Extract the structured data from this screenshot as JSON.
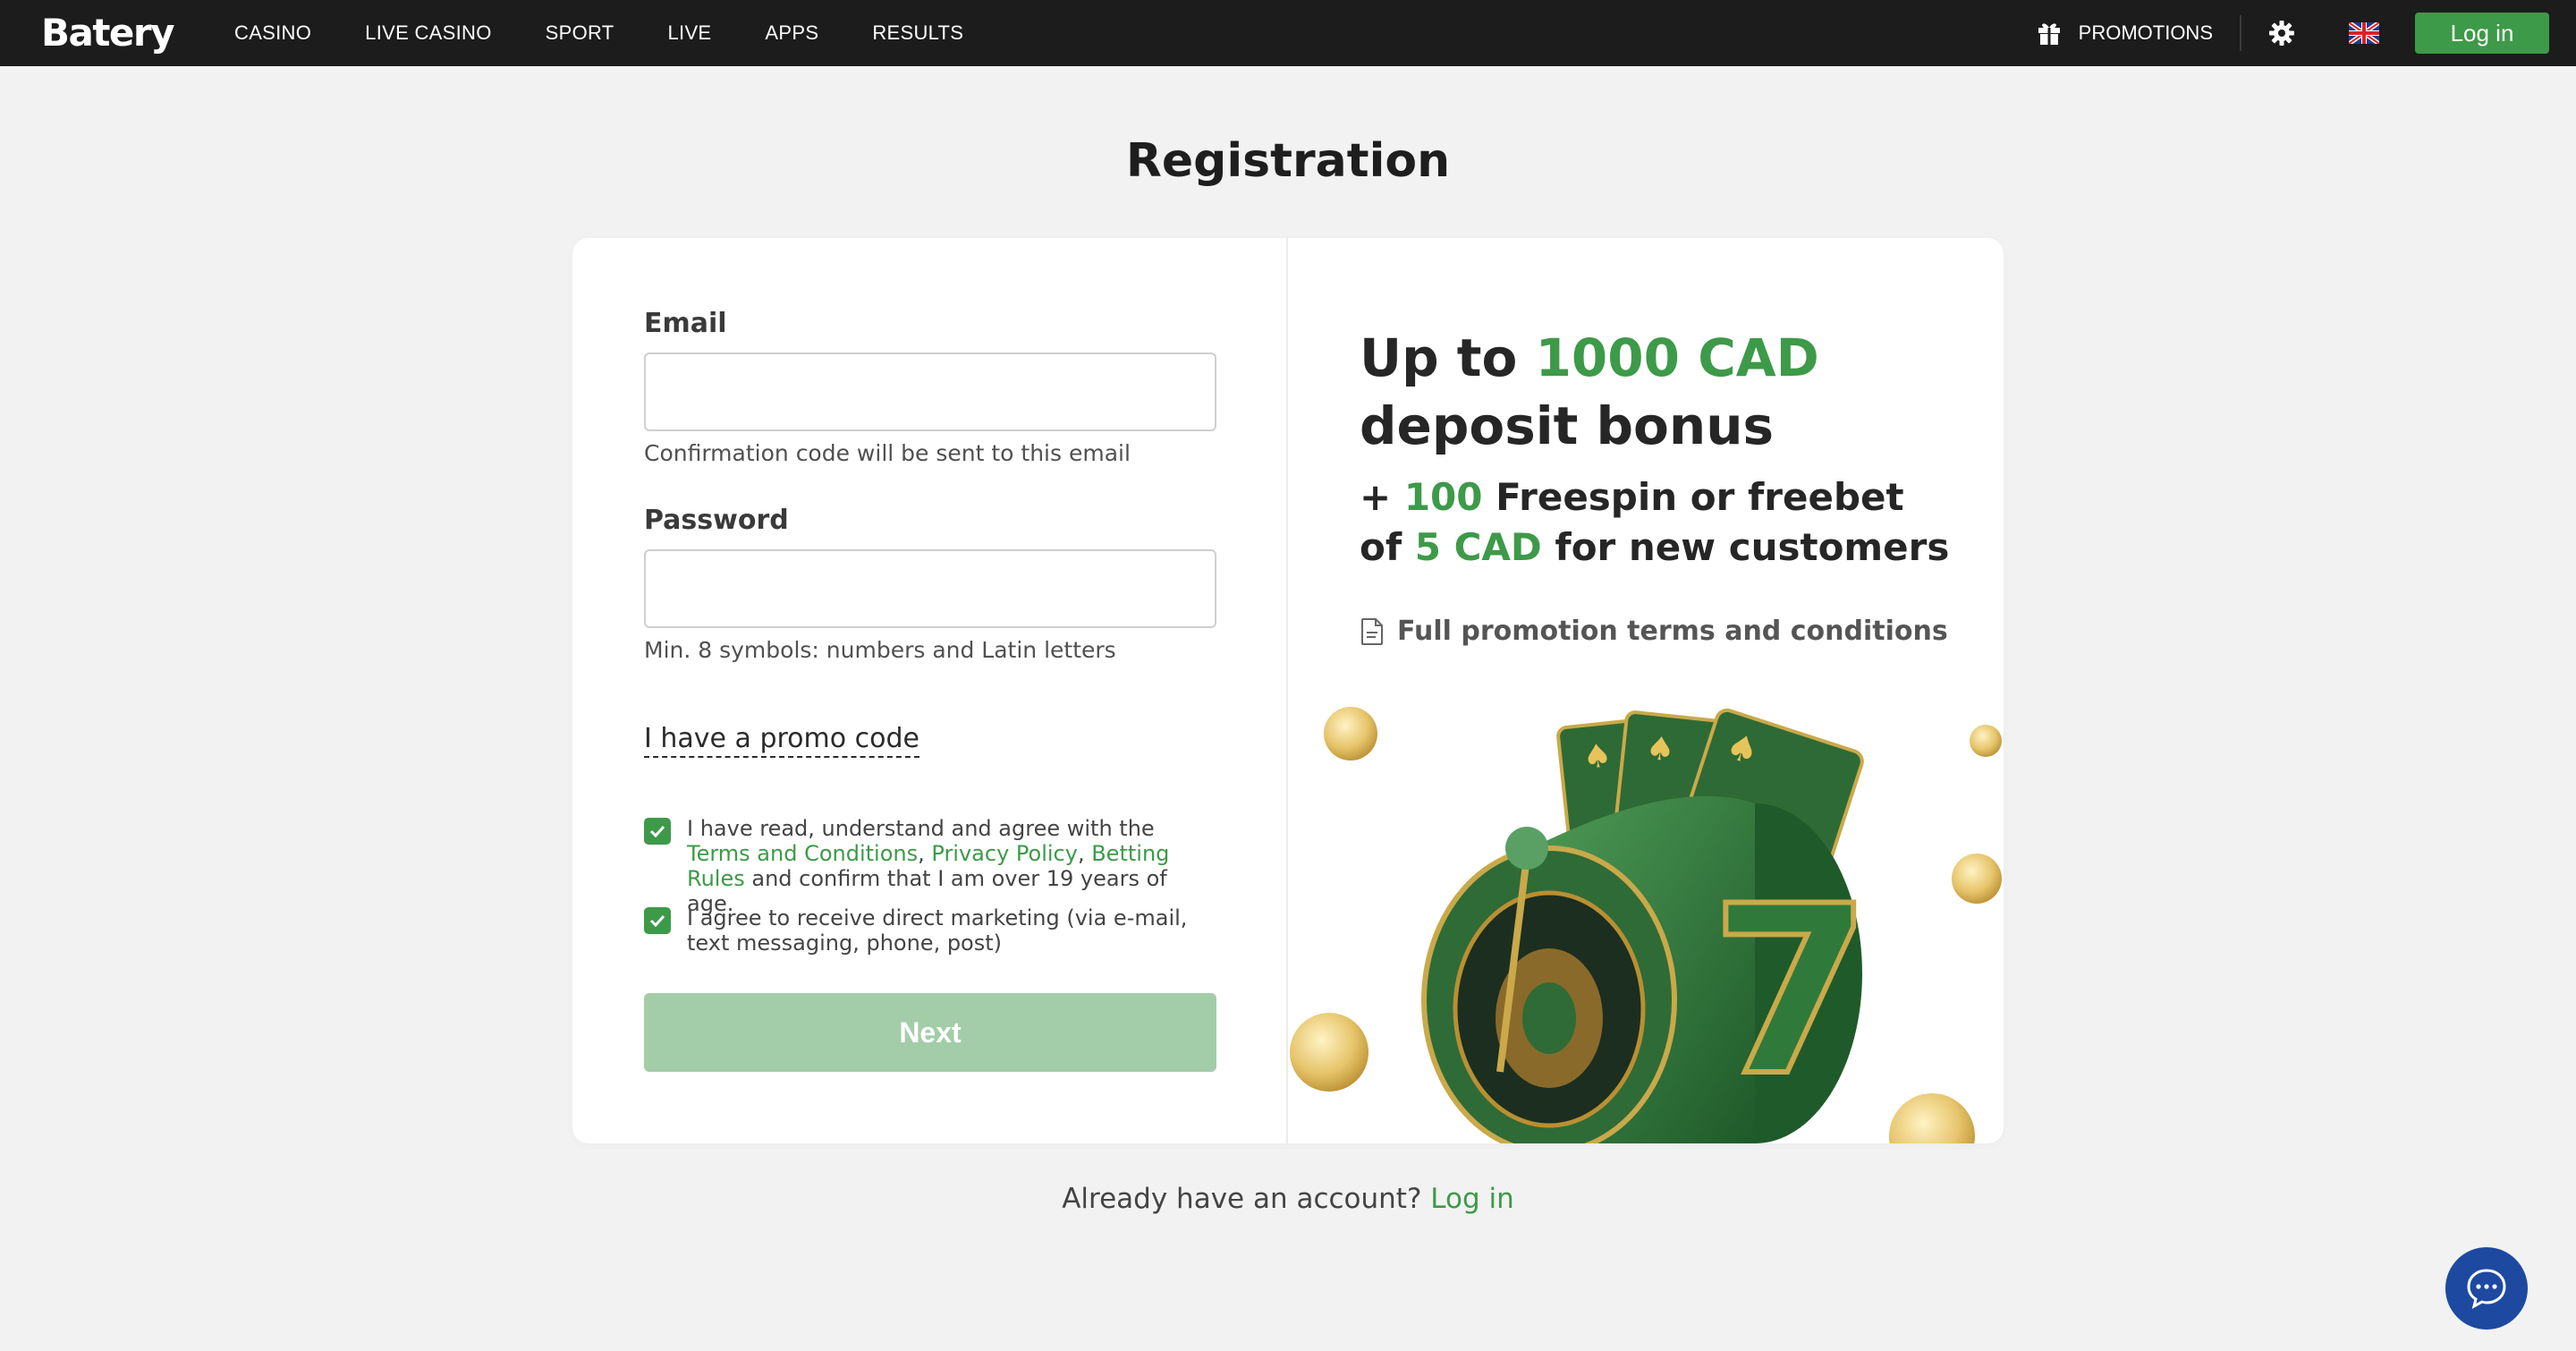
{
  "header": {
    "logo": "Batery",
    "nav": [
      "CASINO",
      "LIVE CASINO",
      "SPORT",
      "LIVE",
      "APPS",
      "RESULTS"
    ],
    "promotions": "PROMOTIONS",
    "login": "Log in"
  },
  "page": {
    "title": "Registration"
  },
  "form": {
    "email_label": "Email",
    "email_value": "",
    "email_hint": "Confirmation code will be sent to this email",
    "password_label": "Password",
    "password_value": "",
    "password_hint": "Min. 8 symbols: numbers and Latin letters",
    "promo_link": "I have a promo code",
    "terms_prefix": "I have read, understand and agree with the ",
    "terms_link": "Terms and Conditions",
    "sep1": ", ",
    "privacy_link": "Privacy Policy",
    "sep2": ", ",
    "betting_link": "Betting Rules",
    "terms_suffix": " and confirm that I am over 19 years of age.",
    "terms_checked": true,
    "marketing_text": "I agree to receive direct marketing (via e-mail, text messaging, phone, post)",
    "marketing_checked": true,
    "next": "Next"
  },
  "bonus": {
    "line1_pre": "Up to ",
    "line1_amount": "1000 CAD",
    "line2": "deposit bonus",
    "line3_pre": "+ ",
    "line3_num": "100",
    "line3_post": " Freespin or freebet",
    "line4_pre": "of ",
    "line4_amount": "5 CAD",
    "line4_post": " for new customers",
    "terms": "Full promotion terms and conditions"
  },
  "footer": {
    "question": "Already have an account?",
    "login": "Log in"
  },
  "colors": {
    "accent": "#3d9a48",
    "topbar": "#1c1c1c",
    "chat": "#1d4aa0"
  }
}
